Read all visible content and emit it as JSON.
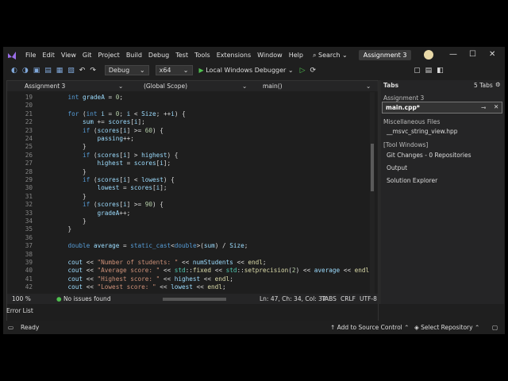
{
  "menu": [
    "File",
    "Edit",
    "View",
    "Git",
    "Project",
    "Build",
    "Debug",
    "Test",
    "Tools",
    "Extensions",
    "Window",
    "Help"
  ],
  "search_label": "Search",
  "project_tab": "Assignment 3",
  "toolbar": {
    "config": "Debug",
    "platform": "x64",
    "run_label": "Local Windows Debugger"
  },
  "navbar": {
    "project": "Assignment 3",
    "scope": "(Global Scope)",
    "member": "main()"
  },
  "code": [
    {
      "n": "19",
      "t": "    <span class=\"k\">int</span> <span class=\"v\">gradeA</span> = <span class=\"n\">0</span>;"
    },
    {
      "n": "20",
      "t": ""
    },
    {
      "n": "21",
      "t": "    <span class=\"k\">for</span> (<span class=\"k\">int</span> <span class=\"v\">i</span> = <span class=\"n\">0</span>; <span class=\"v\">i</span> &lt; <span class=\"v\">Size</span>; ++<span class=\"v\">i</span>) {"
    },
    {
      "n": "22",
      "t": "        <span class=\"v\">sum</span> += <span class=\"v\">scores</span>[<span class=\"v\">i</span>];"
    },
    {
      "n": "23",
      "t": "        <span class=\"k\">if</span> (<span class=\"v\">scores</span>[<span class=\"v\">i</span>] &gt;= <span class=\"n\">60</span>) {"
    },
    {
      "n": "24",
      "t": "            <span class=\"v\">passing</span>++;"
    },
    {
      "n": "25",
      "t": "        }"
    },
    {
      "n": "26",
      "t": "        <span class=\"k\">if</span> (<span class=\"v\">scores</span>[<span class=\"v\">i</span>] &gt; <span class=\"v\">highest</span>) {"
    },
    {
      "n": "27",
      "t": "            <span class=\"v\">highest</span> = <span class=\"v\">scores</span>[<span class=\"v\">i</span>];"
    },
    {
      "n": "28",
      "t": "        }"
    },
    {
      "n": "29",
      "t": "        <span class=\"k\">if</span> (<span class=\"v\">scores</span>[<span class=\"v\">i</span>] &lt; <span class=\"v\">lowest</span>) {"
    },
    {
      "n": "30",
      "t": "            <span class=\"v\">lowest</span> = <span class=\"v\">scores</span>[<span class=\"v\">i</span>];"
    },
    {
      "n": "31",
      "t": "        }"
    },
    {
      "n": "32",
      "t": "        <span class=\"k\">if</span> (<span class=\"v\">scores</span>[<span class=\"v\">i</span>] &gt;= <span class=\"n\">90</span>) {"
    },
    {
      "n": "33",
      "t": "            <span class=\"v\">gradeA</span>++;"
    },
    {
      "n": "34",
      "t": "        }"
    },
    {
      "n": "35",
      "t": "    }"
    },
    {
      "n": "36",
      "t": ""
    },
    {
      "n": "37",
      "t": "    <span class=\"k\">double</span> <span class=\"v\">average</span> = <span class=\"k\">static_cast</span>&lt;<span class=\"k\">double</span>&gt;(<span class=\"v\">sum</span>) / <span class=\"v\">Size</span>;"
    },
    {
      "n": "38",
      "t": ""
    },
    {
      "n": "39",
      "t": "    <span class=\"v\">cout</span> &lt;&lt; <span class=\"s\">\"Number of students: \"</span> &lt;&lt; <span class=\"v\">numStudents</span> &lt;&lt; <span class=\"f\">endl</span>;"
    },
    {
      "n": "40",
      "t": "    <span class=\"v\">cout</span> &lt;&lt; <span class=\"s\">\"Average score: \"</span> &lt;&lt; <span class=\"t\">std</span>::<span class=\"f\">fixed</span> &lt;&lt; <span class=\"t\">std</span>::<span class=\"f\">setprecision</span>(<span class=\"n\">2</span>) &lt;&lt; <span class=\"v\">average</span> &lt;&lt; <span class=\"f\">endl</span>;"
    },
    {
      "n": "41",
      "t": "    <span class=\"v\">cout</span> &lt;&lt; <span class=\"s\">\"Highest score: \"</span> &lt;&lt; <span class=\"v\">highest</span> &lt;&lt; <span class=\"f\">endl</span>;"
    },
    {
      "n": "42",
      "t": "    <span class=\"v\">cout</span> &lt;&lt; <span class=\"s\">\"Lowest score: \"</span> &lt;&lt; <span class=\"v\">lowest</span> &lt;&lt; <span class=\"f\">endl</span>;"
    }
  ],
  "editor_status": {
    "zoom": "100 %",
    "issues": "No issues found",
    "position": "Ln: 47, Ch: 34, Col: 37",
    "tabs": "TABS",
    "eol": "CRLF",
    "encoding": "UTF-8"
  },
  "tabs_panel": {
    "title": "Tabs",
    "count": "5 Tabs",
    "group1": "Assignment 3",
    "active_file": "main.cpp*",
    "group2": "Miscellaneous Files",
    "misc_file": "__msvc_string_view.hpp",
    "group3": "[Tool Windows]",
    "items": [
      "Git Changes - 0 Repositories",
      "Output",
      "Solution Explorer"
    ]
  },
  "error_list": "Error List",
  "status": {
    "ready": "Ready",
    "source_control": "Add to Source Control",
    "repo": "Select Repository"
  }
}
